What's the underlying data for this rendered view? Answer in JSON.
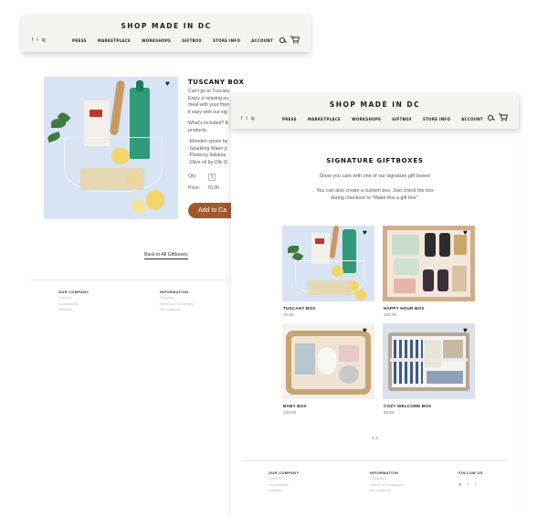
{
  "brand": "SHOP MADE IN DC",
  "nav": [
    "PRESS",
    "MARKETPLACE",
    "WORKSHOPS",
    "GIFTBOX",
    "STORE INFO",
    "ACCOUNT"
  ],
  "social": [
    "f",
    "t",
    "ig"
  ],
  "product_page": {
    "title": "TUSCANY BOX",
    "description_lines": [
      "Can't go to Tuscany? We bring it to you.",
      "Enjoy a relaxing ev",
      "meal with your frien",
      "it easy with our sig",
      "",
      "What's included? A",
      "products.",
      "",
      "-Wooden spoon by",
      "-Sparkling Water p",
      "-Pasta by Italiania",
      "-Olive oil by Olly O"
    ],
    "qty_label": "Qty:",
    "qty_value": "1",
    "price_label": "Price:",
    "price_value": "70.00",
    "add_button": "Add to Ca",
    "back_link": "Back to All Giftboxes"
  },
  "listing_page": {
    "heading": "SIGNATURE GIFTBOXES",
    "intro": "Show you care with one of our signature gift boxes!",
    "custom_line1": "You can also create a custom box. Just check the box",
    "custom_line2": "during checkout to \"Make this a gift box\".",
    "products": [
      {
        "name": "TUSCANY BOX",
        "price": "70.00"
      },
      {
        "name": "HAPPY HOUR BOX",
        "price": "100.00"
      },
      {
        "name": "BABY BOX",
        "price": "130.00"
      },
      {
        "name": "COZY WELCOME BOX",
        "price": "80.00"
      }
    ],
    "pagination": "2 3"
  },
  "footer": {
    "company_heading": "OUR COMPANY",
    "company_links": [
      "Careers",
      "Accessibility",
      "Affiliates"
    ],
    "info_heading": "INFORMATION",
    "info_links": [
      "Shipping",
      "Return & Exchanges",
      "All Locations"
    ],
    "follow_heading": "FOLLOW US"
  },
  "icons": [
    "search-icon",
    "cart-icon",
    "heart-icon",
    "facebook-icon",
    "twitter-icon",
    "instagram-icon"
  ],
  "colors": {
    "header_bg": "#f6f4ef",
    "add_button": "#a15a2b",
    "photo_bg": "#d8e3f3"
  }
}
